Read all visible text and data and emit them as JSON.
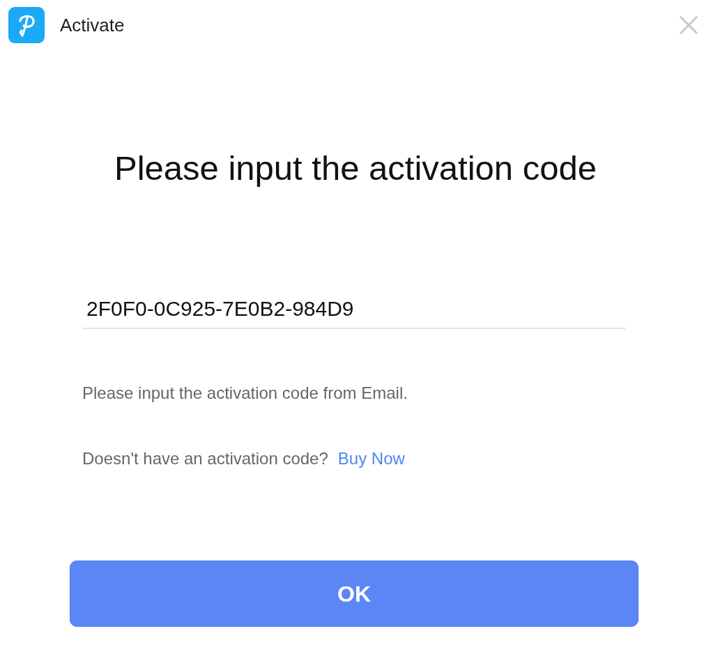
{
  "window": {
    "title": "Activate"
  },
  "heading": "Please input the activation code",
  "code_field": {
    "value": "2F0F0-0C925-7E0B2-984D9"
  },
  "hint": "Please input the activation code from Email.",
  "purchase": {
    "question": "Doesn't have an activation code?",
    "link": "Buy Now"
  },
  "ok_button": "OK"
}
